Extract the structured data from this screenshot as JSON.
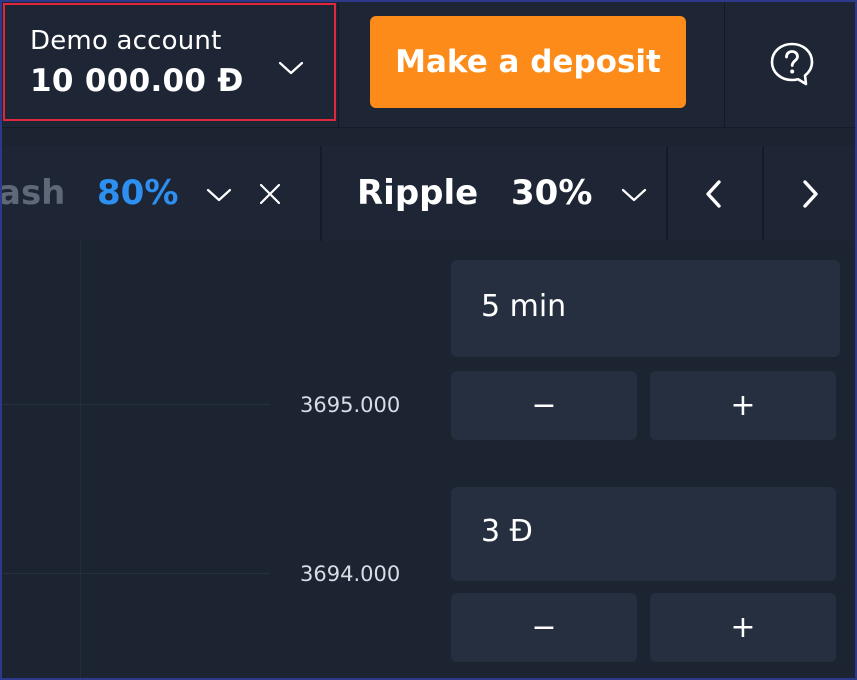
{
  "header": {
    "account_label": "Demo account",
    "account_balance": "10 000.00 Đ",
    "deposit_label": "Make a deposit",
    "icons": {
      "account_dropdown": "chevron-down-icon",
      "help": "help-bubble-icon"
    }
  },
  "tabs": [
    {
      "name": "ash",
      "percent": "80%",
      "active": false
    },
    {
      "name": "Ripple",
      "percent": "30%",
      "active": true
    }
  ],
  "chart": {
    "price_labels": [
      "3695.000",
      "3694.000"
    ]
  },
  "controls": {
    "time_value": "5 min",
    "amount_value": "3 Đ",
    "minus_label": "−",
    "plus_label": "+"
  },
  "colors": {
    "accent_orange": "#fc8b1a",
    "percent_blue": "#2d8ff0",
    "highlight_red": "#e0283c",
    "background": "#1c2432"
  }
}
